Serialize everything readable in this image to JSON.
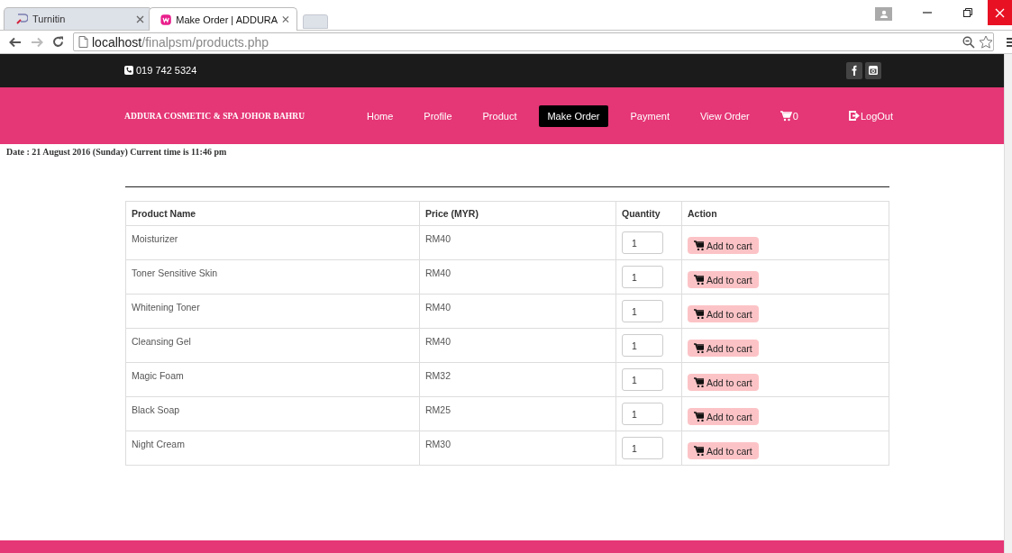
{
  "browser": {
    "tabs": [
      {
        "title": "Turnitin",
        "selected": false
      },
      {
        "title": "Make Order | ADDURA",
        "selected": true
      }
    ],
    "url": {
      "host": "localhost",
      "path": "/finalpsm/products.php"
    }
  },
  "topbar": {
    "phone": "019 742 5324"
  },
  "nav": {
    "brand": "ADDURA COSMETIC & SPA JOHOR BAHRU",
    "items": [
      {
        "kind": "link",
        "label": "Home",
        "selected": false
      },
      {
        "kind": "link",
        "label": "Profile",
        "selected": false
      },
      {
        "kind": "link",
        "label": "Product",
        "selected": false
      },
      {
        "kind": "link",
        "label": "Make Order",
        "selected": true
      },
      {
        "kind": "link",
        "label": "Payment",
        "selected": false
      },
      {
        "kind": "link",
        "label": "View Order",
        "selected": false
      },
      {
        "kind": "cart",
        "label": "0",
        "selected": false
      },
      {
        "kind": "logout",
        "label": "LogOut",
        "selected": false
      }
    ]
  },
  "date_line": "Date : 21 August 2016 (Sunday) Current time is 11:46 pm",
  "table": {
    "columns": [
      "Product Name",
      "Price (MYR)",
      "Quantity",
      "Action"
    ],
    "rows": [
      {
        "name": "Moisturizer",
        "price": "RM40",
        "quantity": "1",
        "action": "Add to cart"
      },
      {
        "name": "Toner Sensitive Skin",
        "price": "RM40",
        "quantity": "1",
        "action": "Add to cart"
      },
      {
        "name": "Whitening Toner",
        "price": "RM40",
        "quantity": "1",
        "action": "Add to cart"
      },
      {
        "name": "Cleansing Gel",
        "price": "RM40",
        "quantity": "1",
        "action": "Add to cart"
      },
      {
        "name": "Magic Foam",
        "price": "RM32",
        "quantity": "1",
        "action": "Add to cart"
      },
      {
        "name": "Black Soap",
        "price": "RM25",
        "quantity": "1",
        "action": "Add to cart"
      },
      {
        "name": "Night Cream",
        "price": "RM30",
        "quantity": "1",
        "action": "Add to cart"
      }
    ]
  }
}
